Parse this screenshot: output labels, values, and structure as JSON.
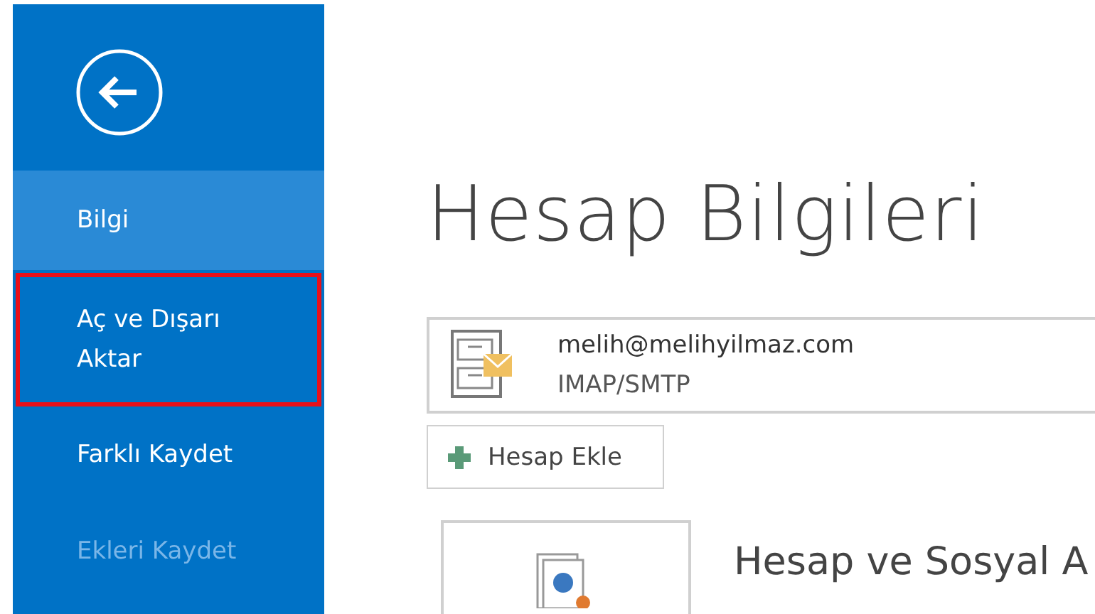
{
  "sidebar": {
    "items": [
      {
        "label": "Bilgi",
        "selected": true,
        "disabled": false,
        "outlined": false
      },
      {
        "label": "Aç ve Dışarı Aktar",
        "selected": false,
        "disabled": false,
        "outlined": true
      },
      {
        "label": "Farklı Kaydet",
        "selected": false,
        "disabled": false,
        "outlined": false
      },
      {
        "label": "Ekleri Kaydet",
        "selected": false,
        "disabled": true,
        "outlined": false
      }
    ]
  },
  "title": "Hesap Bilgileri",
  "account": {
    "email": "melih@melihyilmaz.com",
    "type": "IMAP/SMTP"
  },
  "add_button": "Hesap Ekle",
  "section_title": "Hesap ve Sosyal A"
}
